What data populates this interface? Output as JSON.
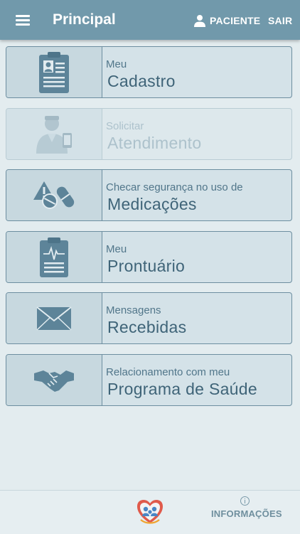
{
  "appbar": {
    "title": "Principal",
    "patient_label": "PACIENTE",
    "logout_label": "SAIR"
  },
  "cards": [
    {
      "line1": "Meu",
      "line2": "Cadastro",
      "icon": "id-card-icon",
      "enabled": true
    },
    {
      "line1": "Solicitar",
      "line2": "Atendimento",
      "icon": "doctor-icon",
      "enabled": false
    },
    {
      "line1": "Checar segurança no uso de",
      "line2": "Medicações",
      "icon": "medication-warning-icon",
      "enabled": true
    },
    {
      "line1": "Meu",
      "line2": "Prontuário",
      "icon": "medical-record-icon",
      "enabled": true
    },
    {
      "line1": "Mensagens",
      "line2": "Recebidas",
      "icon": "envelope-icon",
      "enabled": true
    },
    {
      "line1": "Relacionamento com meu",
      "line2": "Programa de Saúde",
      "icon": "handshake-icon",
      "enabled": true
    }
  ],
  "bottombar": {
    "logo_icon": "heart-family-logo",
    "info_label": "INFORMAÇÕES"
  },
  "colors": {
    "appbar": "#7199ab",
    "background": "#e3ecef",
    "card_border": "#6d8ea0",
    "icon_fill": "#5d8499",
    "text_dark": "#3f6478"
  }
}
